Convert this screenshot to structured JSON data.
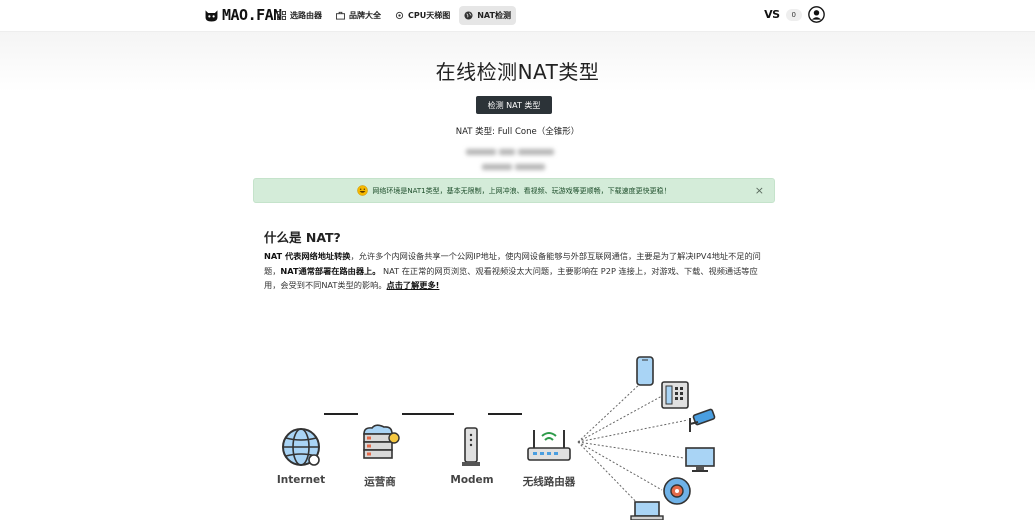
{
  "nav": {
    "brand": "MAO.FAN",
    "items": [
      {
        "label": "选路由器",
        "icon": "grid-icon"
      },
      {
        "label": "品牌大全",
        "icon": "briefcase-icon"
      },
      {
        "label": "CPU天梯图",
        "icon": "cpu-icon"
      },
      {
        "label": "NAT检测",
        "icon": "globe-icon",
        "active": true
      }
    ],
    "vs_label": "VS",
    "vs_count": "0"
  },
  "main": {
    "title": "在线检测NAT类型",
    "detect_button": "检测 NAT 类型",
    "nat_type": "NAT 类型: Full Cone（全锥形）",
    "alert_text": "网络环境是NAT1类型，基本无限制，上网冲浪、看视频、玩游戏等更顺畅，下载速度更快更稳！",
    "alert_close": "×",
    "section_title": "什么是 NAT?",
    "desc_bold1": "NAT 代表网络地址转换",
    "desc_text1": "，允许多个内网设备共享一个公网IP地址，使内网设备能够与外部互联网通信，主要是为了解决IPV4地址不足的问题，",
    "desc_bold2": "NAT通常部署在路由器上。",
    "desc_text2": " NAT 在正常的网页浏览、观看视频没太大问题，主要影响在 P2P 连接上，对游戏、下载、视频通话等应用，会受到不同NAT类型的影响。",
    "desc_link": "点击了解更多!"
  },
  "diagram": {
    "labels": [
      "Internet",
      "运营商",
      "Modem",
      "无线路由器"
    ]
  },
  "colors": {
    "button_bg": "#2c3338",
    "alert_bg": "#d4ecd9",
    "icon_blue": "#4a9ee0"
  }
}
